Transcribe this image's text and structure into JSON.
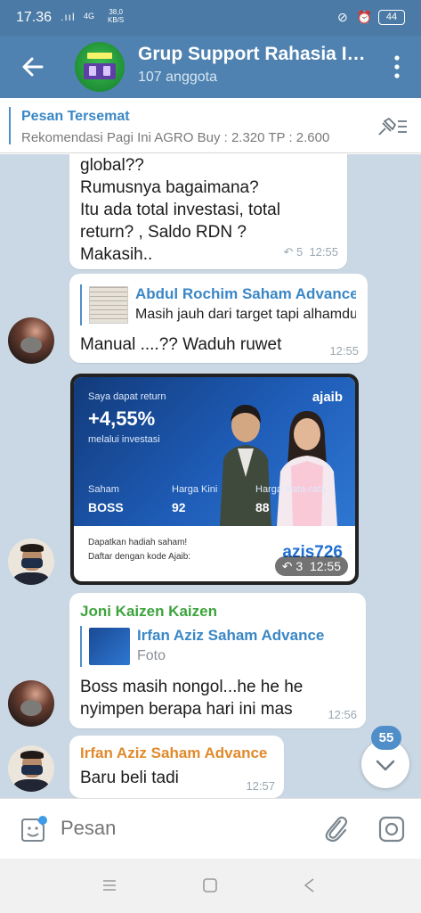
{
  "status_bar": {
    "time": "17.36",
    "signal": ".ııl",
    "network": "4G",
    "speed_value": "38,0",
    "speed_unit": "KB/S",
    "indicators": "⊘ ⏰",
    "battery": "44"
  },
  "header": {
    "title": "Grup Support Rahasia Investor",
    "subtitle": "107 anggota"
  },
  "pinned": {
    "title": "Pesan Tersemat",
    "text": "Rekomendasi Pagi Ini  AGRO  Buy : 2.320 TP : 2.600"
  },
  "messages": [
    {
      "lines": [
        "global??",
        "Rumusnya bagaimana?",
        "Itu ada total investasi, total",
        "return? , Saldo RDN ?",
        "Makasih.."
      ],
      "replies": "5",
      "time": "12:55"
    },
    {
      "reply_to_name": "Abdul Rochim Saham Advance",
      "reply_to_text": "Masih jauh dari target tapi alhamdulillah",
      "text": "Manual ....?? Waduh ruwet",
      "time": "12:55"
    },
    {
      "photo": {
        "caption_small": "Saya dapat return",
        "return_value": "+4,55%",
        "caption_sub": "melalui investasi",
        "brand": "ajaib",
        "col1_label": "Saham",
        "col1_value": "BOSS",
        "col2_label": "Harga Kini",
        "col2_value": "92",
        "col3_label": "Harga Rata-rata",
        "col3_value": "88",
        "promo_line1": "Dapatkan hadiah saham!",
        "promo_line2": "Daftar dengan kode Ajaib:",
        "promo_code": "azis726"
      },
      "replies": "3",
      "time": "12:55"
    },
    {
      "sender": "Joni Kaizen Kaizen",
      "sender_color": "#3da43d",
      "reply_to_name": "Irfan Aziz Saham Advance",
      "reply_to_text": "Foto",
      "lines": [
        "Boss masih nongol...he he he",
        "nyimpen berapa hari ini mas"
      ],
      "time": "12:56"
    },
    {
      "sender": "Irfan Aziz Saham Advance",
      "sender_color": "#e08a2c",
      "text": "Baru beli tadi",
      "time": "12:57"
    }
  ],
  "unread_count": "55",
  "input": {
    "placeholder": "Pesan"
  }
}
